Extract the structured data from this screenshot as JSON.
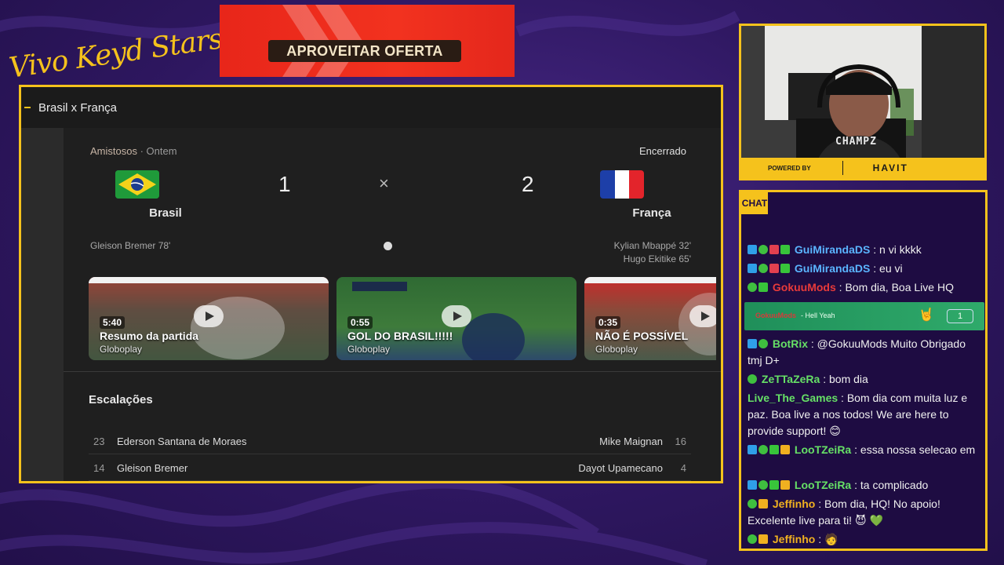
{
  "brand": {
    "text": "Vivo Keyd Stars"
  },
  "ad": {
    "button_label": "APROVEITAR OFERTA"
  },
  "browser": {
    "tab_title": "Brasil x França",
    "match": {
      "competition": "Amistosos",
      "date": "Ontem",
      "status": "Encerrado",
      "home": {
        "name": "Brasil",
        "score": "1",
        "scorers": [
          "Gleison Bremer 78'"
        ]
      },
      "away": {
        "name": "França",
        "score": "2",
        "scorers": [
          "Kylian Mbappé 32'",
          "Hugo Ekitike 65'"
        ]
      },
      "vs_symbol": "×"
    },
    "videos": [
      {
        "duration": "5:40",
        "title": "Resumo da partida",
        "source": "Globoplay"
      },
      {
        "duration": "0:55",
        "title": "GOL DO BRASIL!!!!!",
        "source": "Globoplay"
      },
      {
        "duration": "0:35",
        "title": "NÃO É POSSÍVEL",
        "source": "Globoplay"
      }
    ],
    "lineups": {
      "title": "Escalações",
      "rows": [
        {
          "home_num": "23",
          "home_name": "Ederson Santana de Moraes",
          "away_name": "Mike Maignan",
          "away_num": "16"
        },
        {
          "home_num": "14",
          "home_name": "Gleison Bremer",
          "away_name": "Dayot Upamecano",
          "away_num": "4"
        }
      ]
    }
  },
  "webcam": {
    "overlay_text": "CHAMPZ",
    "sponsor_powered": "POWERED BY",
    "sponsor_brand": "HAVIT"
  },
  "chat": {
    "header": "CHAT",
    "messages": [
      {
        "user": "GuiMirandaDS",
        "color": "#5ab4ff",
        "text": " : n vi kkkk"
      },
      {
        "user": "GuiMirandaDS",
        "color": "#5ab4ff",
        "text": " : eu vi"
      },
      {
        "user": "GokuuMods",
        "color": "#e83a3a",
        "text": " : Bom dia, Boa Live HQ"
      },
      {
        "user": "BotRix",
        "color": "#66e066",
        "text": " : @GokuuMods Muito Obrigado tmj D+"
      },
      {
        "user": "ZeTTaZeRa",
        "color": "#66e066",
        "text": " : bom dia"
      },
      {
        "user": "Live_The_Games",
        "color": "#66e066",
        "text": " : Bom dia com muita luz e paz. Boa live a nos todos! We are here to provide support! 😊"
      },
      {
        "user": "LooTZeiRa",
        "color": "#66e066",
        "text": " : essa nossa selecao em"
      },
      {
        "user": "LooTZeiRa",
        "color": "#66e066",
        "text": " : ta complicado"
      },
      {
        "user": "Jeffinho",
        "color": "#f0b020",
        "text": " : Bom dia, HQ! No apoio! Excelente live para ti! 😈 💚"
      },
      {
        "user": "Jeffinho",
        "color": "#f0b020",
        "text": " : 🧑"
      }
    ],
    "highlight": {
      "user": "GokuuMods",
      "text": "- Hell Yeah",
      "emote": "🤘",
      "count": "1"
    }
  }
}
